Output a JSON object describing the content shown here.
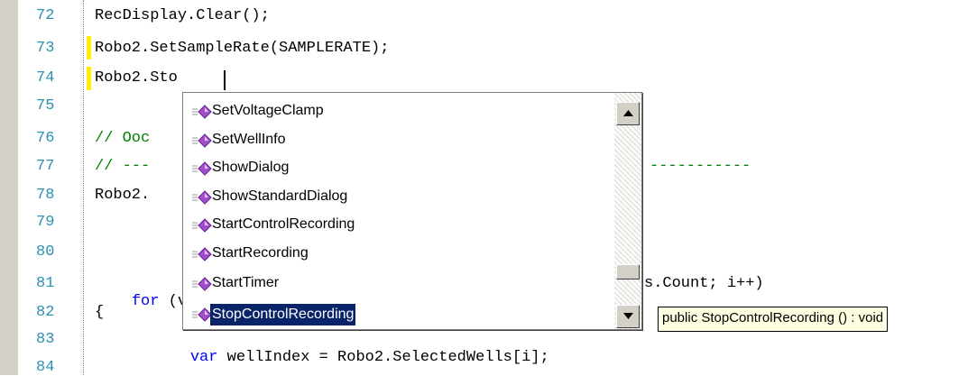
{
  "editor": {
    "line_numbers": [
      "72",
      "73",
      "74",
      "75",
      "76",
      "77",
      "78",
      "79",
      "80",
      "81",
      "82",
      "83",
      "84"
    ],
    "lines": {
      "l72": "RecDisplay.Clear();",
      "l73": "Robo2.SetSampleRate(SAMPLERATE);",
      "l74": "Robo2.Sto",
      "l76": "// Ooc",
      "l77_start": "// ---",
      "l77_end": "-----------",
      "l78": "Robo2.",
      "l81_kw": "for",
      "l81_start": " (v",
      "l81_end": "s.Count; i++)",
      "l82": "{",
      "l83_kw": "var",
      "l83_rest": " wellIndex = Robo2.SelectedWells[i];"
    }
  },
  "intellisense": {
    "items": [
      {
        "label": "SetVoltageClamp"
      },
      {
        "label": "SetWellInfo"
      },
      {
        "label": "ShowDialog"
      },
      {
        "label": "ShowStandardDialog"
      },
      {
        "label": "StartControlRecording"
      },
      {
        "label": "StartRecording"
      },
      {
        "label": "StartTimer"
      },
      {
        "label": "StopControlRecording"
      }
    ],
    "selected": "StopControlRecording",
    "icon_name": "method-icon"
  },
  "tooltip": {
    "text": "public StopControlRecording () : void"
  },
  "colors": {
    "selection": "#0a246a",
    "tooltip_bg": "#ffffe1",
    "line_number": "#2b91af",
    "keyword": "#0000ff",
    "comment": "#008000",
    "change_marker": "#ffee00"
  }
}
